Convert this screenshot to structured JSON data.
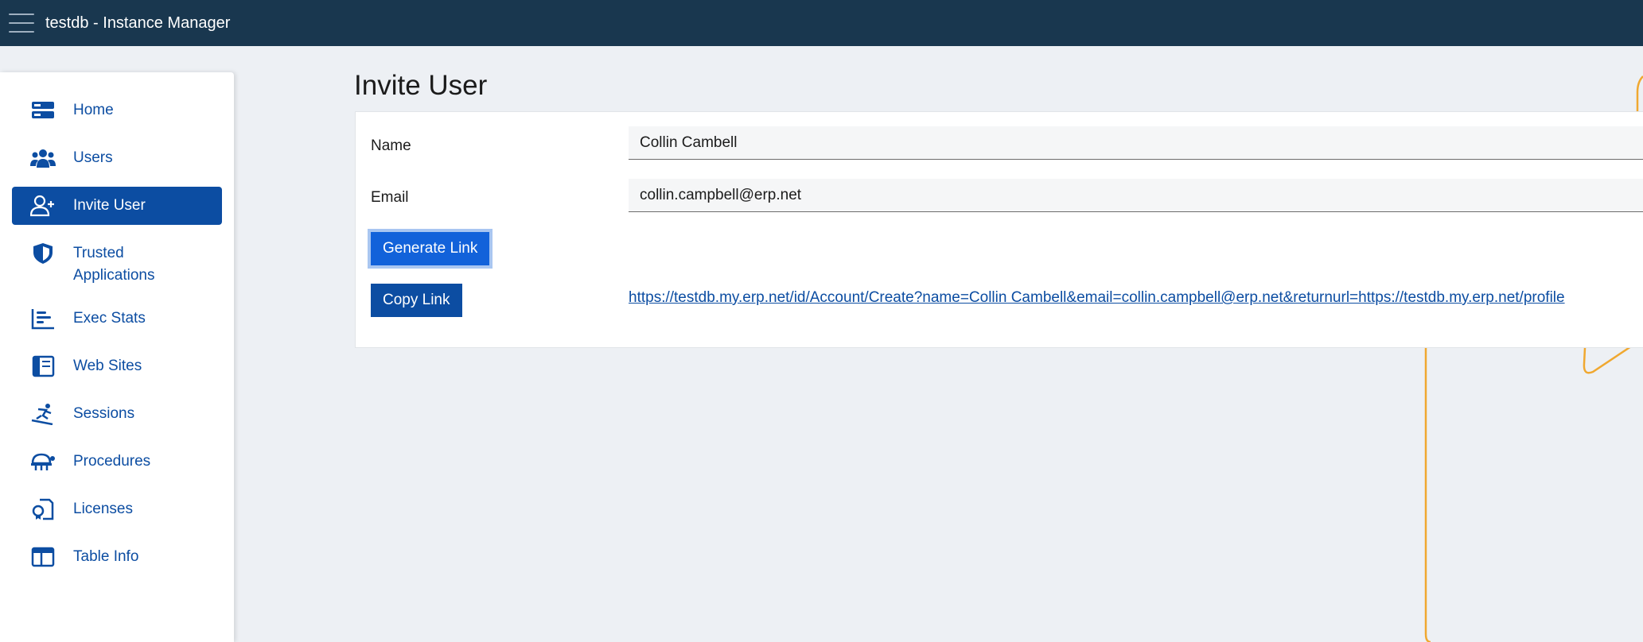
{
  "header": {
    "title": "testdb - Instance Manager"
  },
  "sidebar": {
    "items": [
      {
        "label": "Home",
        "icon": "server-icon",
        "active": false
      },
      {
        "label": "Users",
        "icon": "users-icon",
        "active": false
      },
      {
        "label": "Invite User",
        "icon": "user-plus-icon",
        "active": true
      },
      {
        "label": "Trusted Applications",
        "icon": "shield-icon",
        "active": false
      },
      {
        "label": "Exec Stats",
        "icon": "bar-chart-icon",
        "active": false
      },
      {
        "label": "Web Sites",
        "icon": "web-site-icon",
        "active": false
      },
      {
        "label": "Sessions",
        "icon": "snowboarder-icon",
        "active": false
      },
      {
        "label": "Procedures",
        "icon": "procedure-icon",
        "active": false
      },
      {
        "label": "Licenses",
        "icon": "license-icon",
        "active": false
      },
      {
        "label": "Table Info",
        "icon": "table-icon",
        "active": false
      }
    ]
  },
  "main": {
    "title": "Invite User",
    "form": {
      "name_label": "Name",
      "name_value": "Collin Cambell",
      "email_label": "Email",
      "email_value": "collin.campbell@erp.net",
      "generate_label": "Generate Link",
      "copy_label": "Copy Link",
      "link": "https://testdb.my.erp.net/id/Account/Create?name=Collin Cambell&email=collin.campbell@erp.net&returnurl=https://testdb.my.erp.net/profile"
    }
  },
  "colors": {
    "topbar": "#19374f",
    "accent": "#0c4da2",
    "generate_button": "#1262da",
    "background": "#edf0f4",
    "decoration": "#f0a830"
  }
}
